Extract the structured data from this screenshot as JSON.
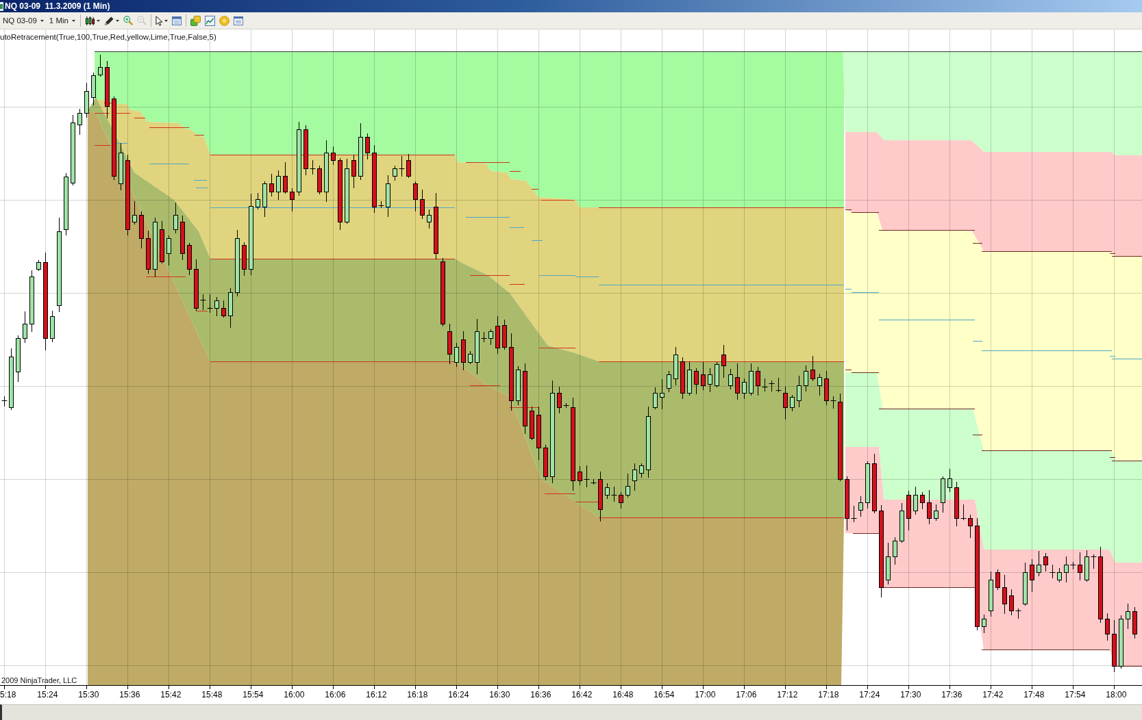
{
  "window": {
    "title": "NQ 03-09  11.3.2009 (1 Min)"
  },
  "toolbar": {
    "instrument": "NQ 03-09",
    "interval": "1 Min",
    "groups": [
      {
        "tools": [
          {
            "kind": "chart-style",
            "menu": true,
            "disabled": false
          },
          {
            "kind": "draw",
            "menu": true,
            "disabled": false
          },
          {
            "kind": "zoom-in",
            "menu": false,
            "disabled": false
          },
          {
            "kind": "zoom-out",
            "menu": false,
            "disabled": true
          }
        ]
      },
      {
        "tools": [
          {
            "kind": "pointer",
            "menu": true,
            "disabled": false
          },
          {
            "kind": "properties",
            "menu": false,
            "disabled": false
          }
        ]
      },
      {
        "tools": [
          {
            "kind": "instruments",
            "menu": false,
            "disabled": false
          },
          {
            "kind": "chart",
            "menu": false,
            "disabled": false
          },
          {
            "kind": "coin",
            "menu": false,
            "disabled": false
          },
          {
            "kind": "list",
            "menu": false,
            "disabled": false
          }
        ]
      }
    ]
  },
  "chart": {
    "indicator_label": "utoRetracement(True,100,True,Red,yellow,Lime,True,False,5)",
    "copyright": "2009 NinjaTrader, LLC",
    "time_axis": [
      "5:18",
      "15:24",
      "15:30",
      "15:36",
      "15:42",
      "15:48",
      "15:54",
      "16:00",
      "16:06",
      "16:12",
      "16:18",
      "16:24",
      "16:30",
      "16:36",
      "16:42",
      "16:48",
      "16:54",
      "17:00",
      "17:06",
      "17:12",
      "17:18",
      "17:24",
      "17:30",
      "17:36",
      "17:42",
      "17:48",
      "17:54",
      "18:00"
    ]
  }
}
